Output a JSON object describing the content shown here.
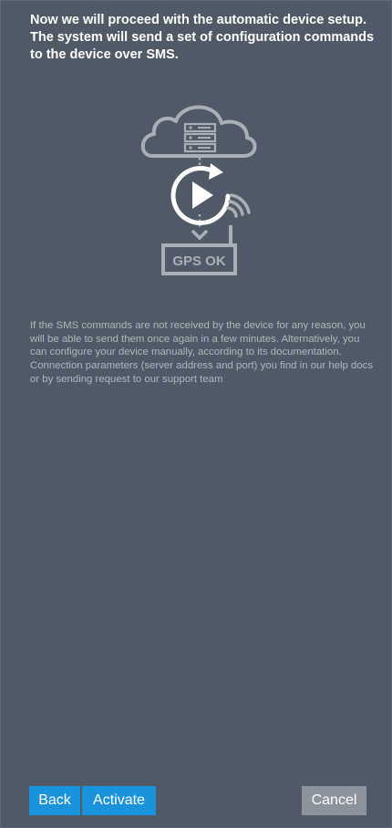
{
  "dialog": {
    "intro_text": "Now we will proceed with the automatic device setup. The system will send a set of configuration commands to the device over SMS.",
    "illustration_label": "GPS OK",
    "note_text": "If the SMS commands are not received by the device for any reason, you will be able to send them once again in a few minutes. Alternatively, you can configure your device manually, according to its documentation. Connection parameters (server address and port) you find in our help docs or by sending request to our support team"
  },
  "buttons": {
    "back": "Back",
    "activate": "Activate",
    "cancel": "Cancel"
  },
  "colors": {
    "background": "#4f5a66",
    "primary_button": "#1a93dc",
    "secondary_button": "#8c939c",
    "illustration": "#a9afb6",
    "play_icon": "#ffffff"
  },
  "icons": [
    "cloud-icon",
    "server-stack-icon",
    "play-refresh-icon",
    "arrow-down-icon",
    "signal-waves-icon",
    "gps-device-icon"
  ]
}
